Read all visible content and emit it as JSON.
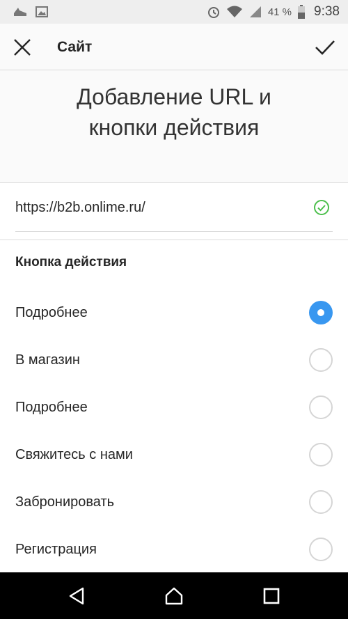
{
  "status_bar": {
    "icons": [
      "shoe-icon",
      "image-icon",
      "alarm-icon",
      "wifi-icon",
      "signal-icon",
      "battery-icon"
    ],
    "battery_percent": "41 %",
    "time": "9:38"
  },
  "app_bar": {
    "title": "Сайт",
    "close_icon": "close-icon",
    "done_icon": "check-icon"
  },
  "heading": "Добавление URL и\nкнопки действия",
  "url_field": {
    "value": "https://b2b.onlime.ru/",
    "status_icon": "check-circle-icon",
    "status_color": "#4cbf4c"
  },
  "action_section": {
    "label": "Кнопка действия",
    "options": [
      {
        "label": "Подробнее",
        "selected": true
      },
      {
        "label": "В магазин",
        "selected": false
      },
      {
        "label": "Подробнее",
        "selected": false
      },
      {
        "label": "Свяжитесь с нами",
        "selected": false
      },
      {
        "label": "Забронировать",
        "selected": false
      },
      {
        "label": "Регистрация",
        "selected": false
      }
    ]
  },
  "colors": {
    "accent": "#3897f0",
    "nav_bar": "#000000"
  },
  "nav_bar": {
    "buttons": [
      "back-icon",
      "home-icon",
      "recents-icon"
    ]
  }
}
